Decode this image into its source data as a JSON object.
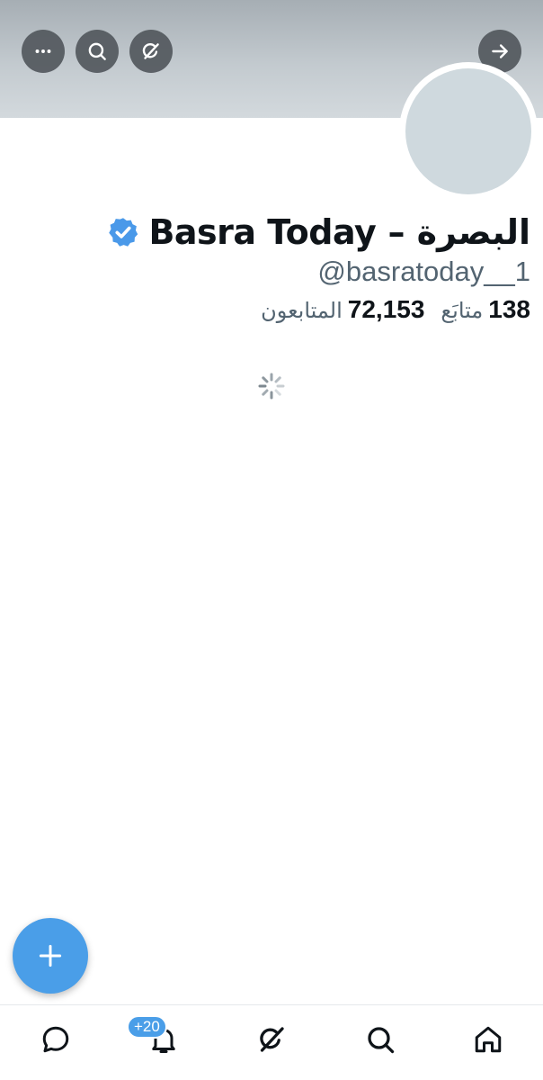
{
  "header": {
    "buttons": [
      {
        "name": "more-options",
        "icon": "ellipsis-icon"
      },
      {
        "name": "search",
        "icon": "search-icon"
      },
      {
        "name": "grok",
        "icon": "grok-icon"
      },
      {
        "name": "forward",
        "icon": "arrow-right-icon"
      }
    ]
  },
  "profile": {
    "display_name": "البصرة – Basra Today",
    "verified": true,
    "verified_color": "#4a99e9",
    "handle": "@basratoday__1",
    "following_count": "138",
    "following_label": "متابَع",
    "followers_count": "72,153",
    "followers_label": "المتابعون"
  },
  "loading": true,
  "fab": {
    "icon": "plus-icon",
    "color": "#4a9ee8"
  },
  "tabbar": {
    "tabs": [
      {
        "name": "messages",
        "icon": "chat-bubble-icon"
      },
      {
        "name": "notifications",
        "icon": "bell-icon",
        "badge": "+20"
      },
      {
        "name": "grok",
        "icon": "grok-icon"
      },
      {
        "name": "explore",
        "icon": "search-icon"
      },
      {
        "name": "home",
        "icon": "home-icon"
      }
    ]
  }
}
